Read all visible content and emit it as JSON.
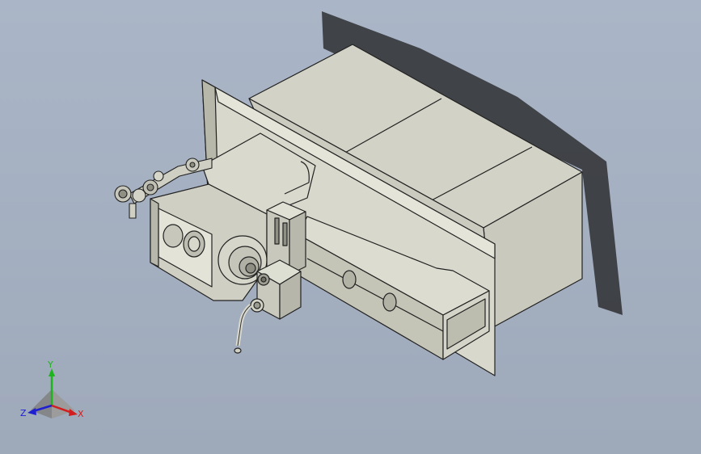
{
  "viewport": {
    "background_top": "#aab6c7",
    "background_bottom": "#9ea9ba"
  },
  "model": {
    "body_color": "#d7d7cb",
    "light_face": "#e6e6dc",
    "dark_face": "#b9b9ad",
    "edge_color": "#222222",
    "shadow_color": "#1e1e1e"
  },
  "triad": {
    "x_label": "X",
    "y_label": "Y",
    "z_label": "Z",
    "x_color": "#d21e1e",
    "y_color": "#1eb41e",
    "z_color": "#1e1ed2"
  }
}
